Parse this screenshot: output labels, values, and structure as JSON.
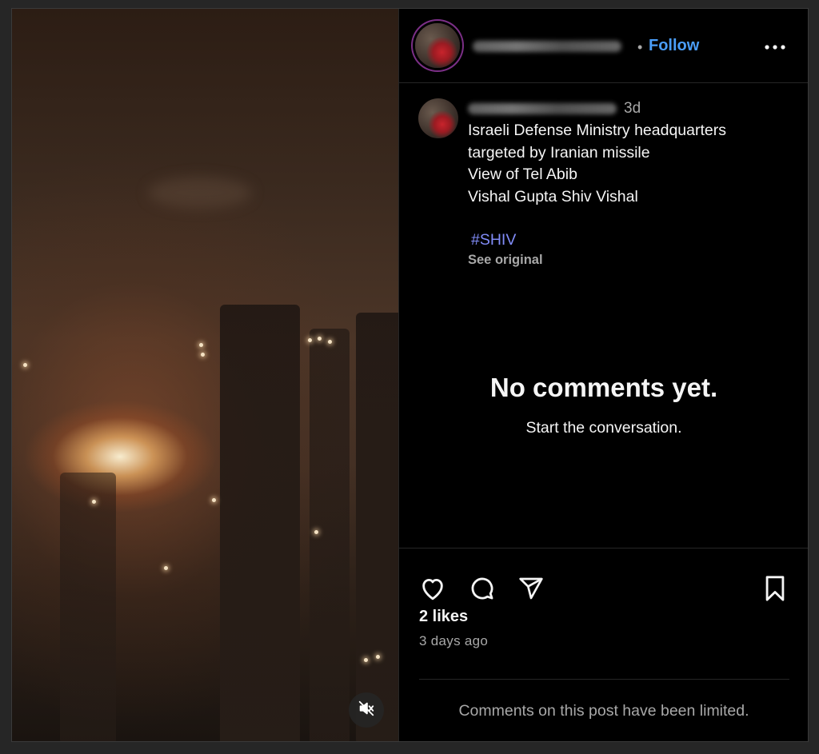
{
  "media": {
    "type": "video",
    "mute_icon": "speaker-muted-icon"
  },
  "header": {
    "separator": "•",
    "follow_label": "Follow",
    "more_icon": "more-options-icon"
  },
  "caption": {
    "time": "3d",
    "lines": [
      "Israeli Defense Ministry headquarters",
      "targeted by Iranian missile",
      "View of Tel Abib",
      "Vishal Gupta Shiv Vishal"
    ],
    "hashtag": "#SHIV",
    "see_original": "See original"
  },
  "comments": {
    "empty_title": "No comments yet.",
    "empty_subtitle": "Start the conversation."
  },
  "actions": {
    "icons": [
      "heart-icon",
      "comment-icon",
      "share-icon",
      "bookmark-icon"
    ],
    "likes": "2 likes",
    "time_ago": "3 days ago",
    "limited_notice": "Comments on this post have been limited."
  },
  "colors": {
    "background": "#000000",
    "text_primary": "#f5f5f5",
    "text_secondary": "#a8a8a8",
    "follow_blue": "#4a9df8",
    "hashtag": "#818cf8",
    "divider": "#262626"
  }
}
